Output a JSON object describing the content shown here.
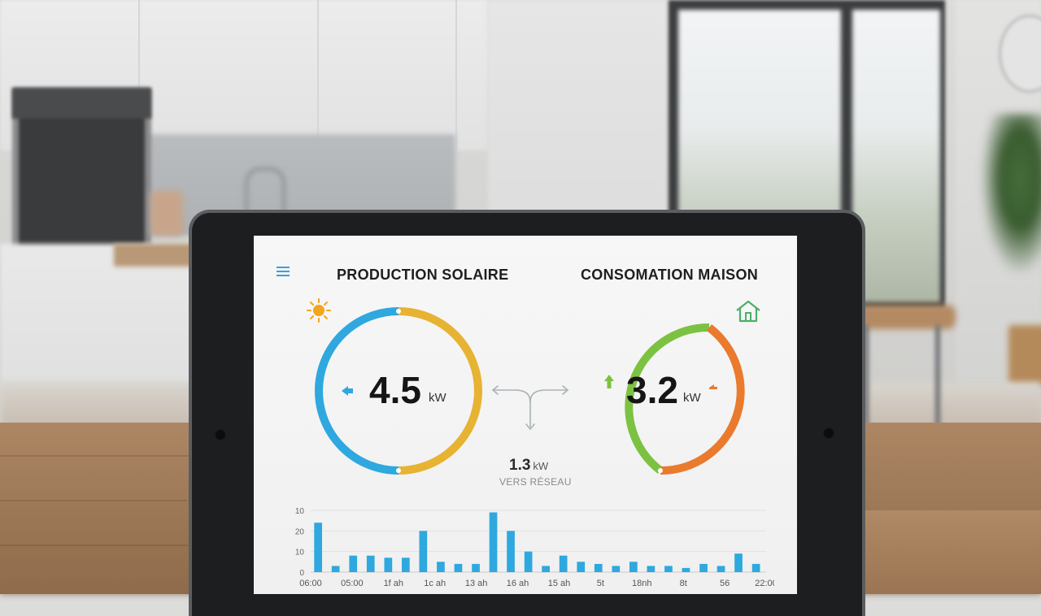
{
  "dashboard": {
    "production": {
      "title": "PRODUCTION SOLAIRE",
      "value": "4.5",
      "unit": "kW"
    },
    "consumption": {
      "title": "CONSOMATION MAISON",
      "value": "3.2",
      "unit": "kW"
    },
    "grid_export": {
      "value": "1.3",
      "unit": "kW",
      "label": "VERS RÉSEAU"
    }
  },
  "colors": {
    "solar_blue": "#2ea8df",
    "solar_yellow": "#e6b332",
    "home_green": "#7cc242",
    "home_orange": "#ea7a2e",
    "bar_blue": "#2ea8df"
  },
  "chart_data": {
    "type": "bar",
    "ylim": [
      0,
      30
    ],
    "yticks": [
      "0",
      "10",
      "20",
      "10"
    ],
    "xtick_labels": [
      "06:00",
      "05:00",
      "1f ah",
      "1c ah",
      "13 ah",
      "16 ah",
      "15 ah",
      "5t",
      "18nh",
      "8t",
      "56",
      "22:00"
    ],
    "series": [
      {
        "values": [
          24,
          3,
          8,
          8,
          7,
          7,
          20,
          5,
          4,
          4,
          29,
          20,
          10,
          3,
          8,
          5,
          4,
          3,
          5,
          3,
          3,
          2,
          4,
          3,
          9,
          4
        ]
      }
    ]
  }
}
